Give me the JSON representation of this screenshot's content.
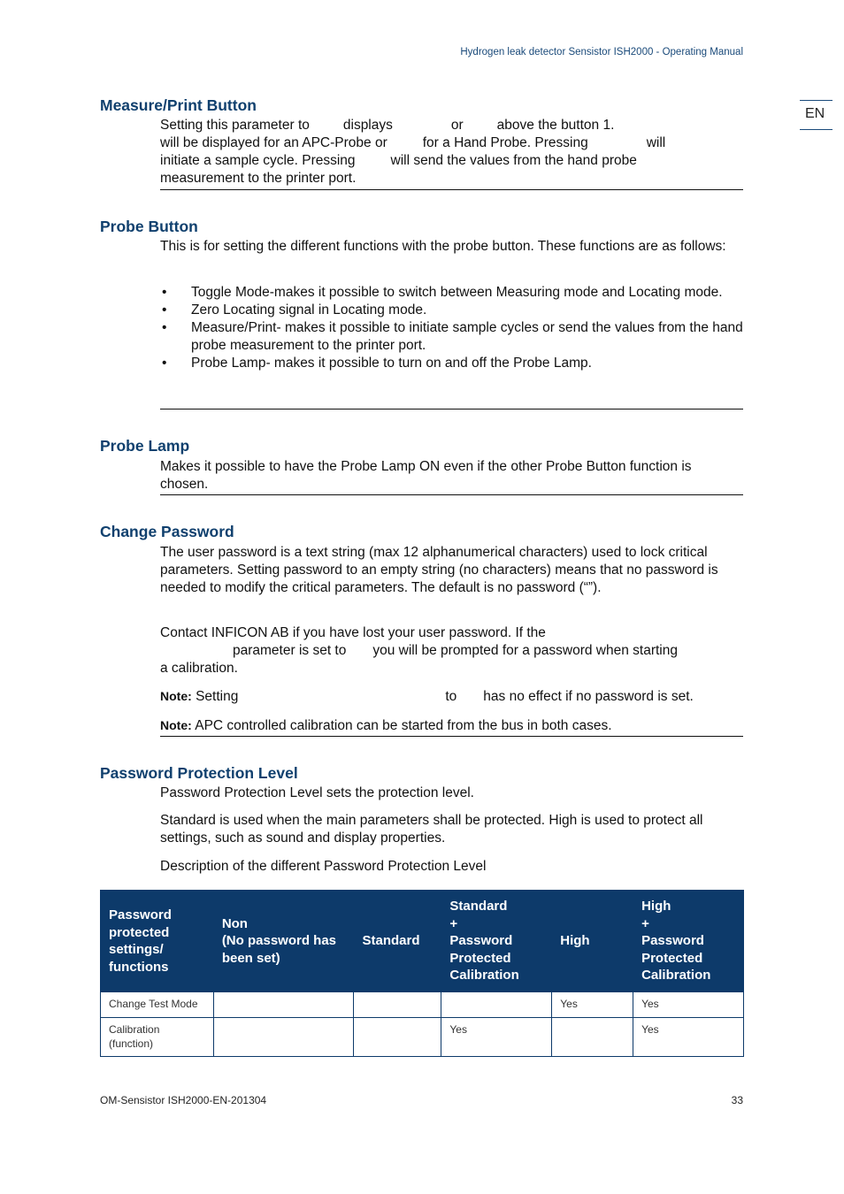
{
  "header": {
    "running_title": "Hydrogen leak detector Sensistor ISH2000  - Operating Manual",
    "language_tab": "EN"
  },
  "sections": {
    "measure_print": {
      "heading": "Measure/Print Button",
      "line1_a": "Setting this parameter to",
      "line1_b": "displays",
      "line1_c": "or",
      "line1_d": "above the button 1.",
      "line2_a": "will be displayed for an APC-Probe or",
      "line2_b": "for a Hand Probe. Pressing",
      "line2_c": "will",
      "line3_a": "initiate a sample cycle. Pressing",
      "line3_b": "will send the values from the hand probe",
      "line4": "measurement to the printer port."
    },
    "probe_button": {
      "heading": "Probe Button",
      "intro": "This is for setting the different functions with the probe button. These functions are as follows:",
      "bullet_char": "•",
      "items": [
        "Toggle Mode-makes it possible to switch between Measuring mode and Locating mode.",
        "Zero Locating signal in Locating mode.",
        "Measure/Print- makes it possible to initiate sample cycles or send the values from the hand probe measurement to the printer port.",
        "Probe Lamp- makes it possible to turn on and off the Probe Lamp."
      ]
    },
    "probe_lamp": {
      "heading": "Probe Lamp",
      "text": "Makes it possible to have the Probe Lamp ON even if the other Probe Button function is chosen."
    },
    "change_password": {
      "heading": "Change Password",
      "para1": "The user password is a text string (max 12 alphanumerical characters) used to lock critical parameters. Setting password to an empty string (no characters) means that no password is needed to modify the critical parameters. The default is no password (“”).",
      "para2_line1": "Contact INFICON AB if you have lost your user password. If the",
      "para2_line2_a": "parameter is set to",
      "para2_line2_b": "you will be prompted for a password when starting",
      "para2_line3": "a calibration.",
      "note1_label": "Note:",
      "note1_a": "Setting",
      "note1_b": "to",
      "note1_c": "has no effect if no password is set.",
      "note2_label": "Note:",
      "note2_text": "APC controlled calibration can be started from the bus in both cases."
    },
    "password_protection": {
      "heading": "Password Protection Level",
      "para1": "Password Protection Level sets the protection level.",
      "para2": "Standard is used when the main parameters shall be protected. High is used to protect all settings, such as sound and display properties.",
      "para3": "Description of the different Password Protection Level"
    }
  },
  "table": {
    "headers": [
      "Password protected settings/ functions",
      "Non (No password has been set)",
      "Standard",
      "Standard + Password Protected Calibration",
      "High",
      "High + Password Protected Calibration"
    ],
    "header_lines": [
      [
        "Password",
        "protected",
        "settings/",
        "functions"
      ],
      [
        "Non",
        "(No password has",
        "been set)"
      ],
      [
        "Standard"
      ],
      [
        "Standard",
        "+",
        "Password",
        "Protected",
        "Calibration"
      ],
      [
        "High"
      ],
      [
        "High",
        "+",
        "Password",
        "Protected",
        "Calibration"
      ]
    ],
    "rows": [
      [
        "Change Test Mode",
        "",
        "",
        "",
        "Yes",
        "Yes"
      ],
      [
        "Calibration (function)",
        "",
        "",
        "Yes",
        "",
        "Yes"
      ]
    ],
    "row_lines": [
      [
        [
          "Change Test Mode"
        ]
      ],
      [
        [
          "Calibration",
          "(function)"
        ]
      ]
    ],
    "header_bg": "#0d3a6a"
  },
  "footer": {
    "document_id": "OM-Sensistor ISH2000-EN-201304",
    "page_number": "33"
  }
}
